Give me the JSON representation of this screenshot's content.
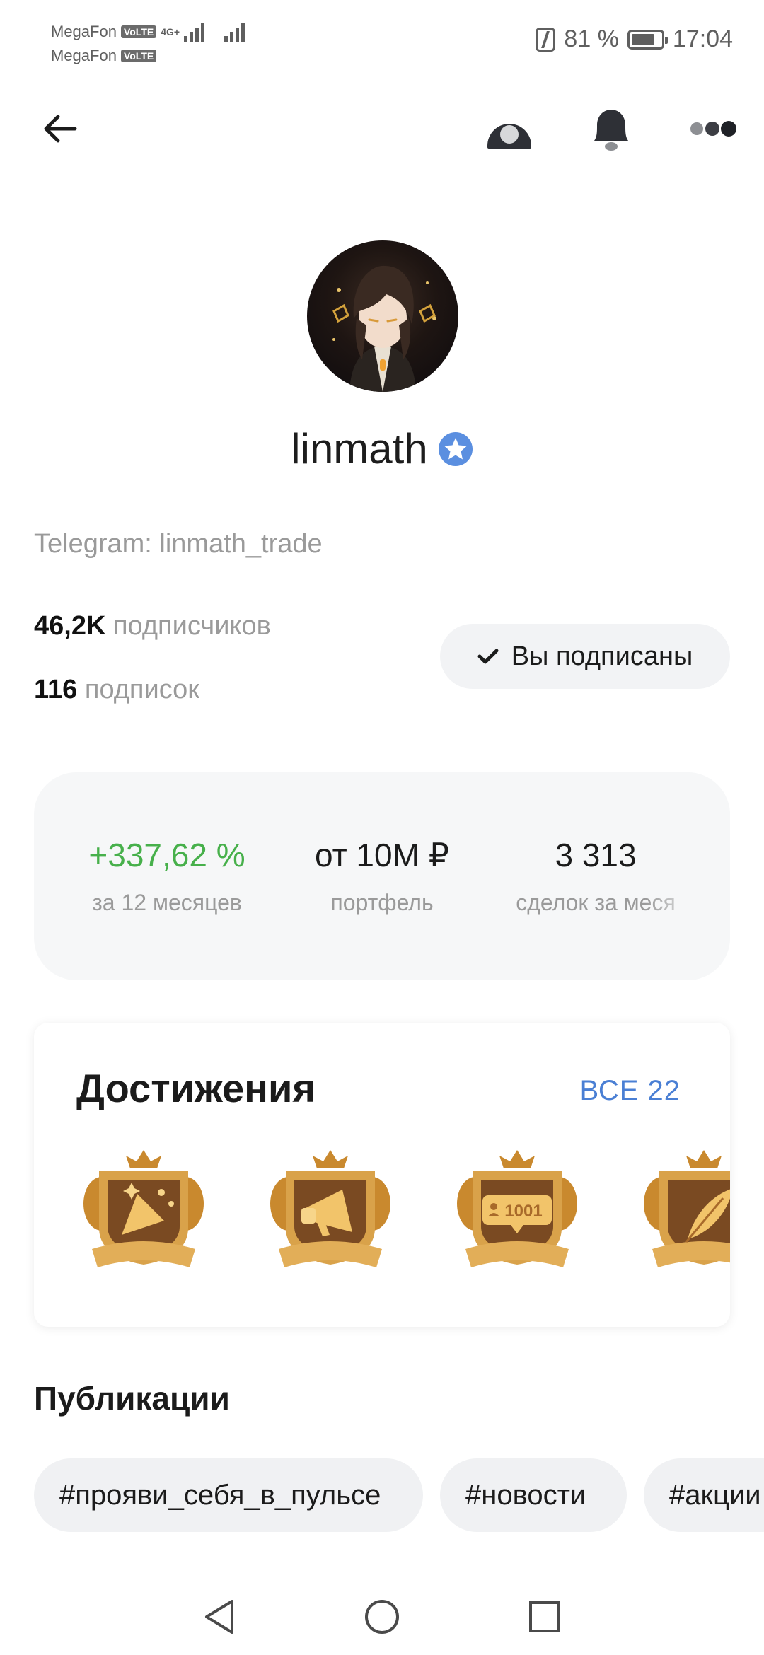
{
  "status_bar": {
    "carrier1": "MegaFon",
    "carrier2": "MegaFon",
    "volte": "VoLTE",
    "network": "4G+",
    "battery_text": "81 %",
    "battery_level": 0.81,
    "time": "17:04"
  },
  "nav": {
    "icons": [
      "back-arrow-icon",
      "gift-icon",
      "bell-icon",
      "more-icon"
    ]
  },
  "profile": {
    "username": "linmath",
    "verified": true,
    "telegram": "Telegram: linmath_trade",
    "followers_count": "46,2K",
    "followers_label": "подписчиков",
    "following_count": "116",
    "following_label": "подписок",
    "subscribed_label": "Вы подписаны"
  },
  "stats": [
    {
      "value": "+337,62 %",
      "caption": "за 12 месяцев"
    },
    {
      "value": "от 10M ₽",
      "caption": "портфель"
    },
    {
      "value": "3 313",
      "caption": "сделок за меся"
    }
  ],
  "colors": {
    "accent": "#4a7fd4",
    "positive": "#47b04b",
    "verified": "#5b8fe0"
  },
  "achievements": {
    "title": "Достижения",
    "all_label": "ВСЕ 22",
    "badges": [
      {
        "icon": "party-popper-icon"
      },
      {
        "icon": "megaphone-icon"
      },
      {
        "icon": "followers-1001-icon",
        "label": "1001"
      },
      {
        "icon": "feather-icon"
      }
    ]
  },
  "publications": {
    "title": "Публикации",
    "tags": [
      "#прояви_себя_в_пульсе",
      "#новости",
      "#акции"
    ]
  },
  "system_nav": [
    "back-triangle-icon",
    "home-circle-icon",
    "recents-square-icon"
  ]
}
